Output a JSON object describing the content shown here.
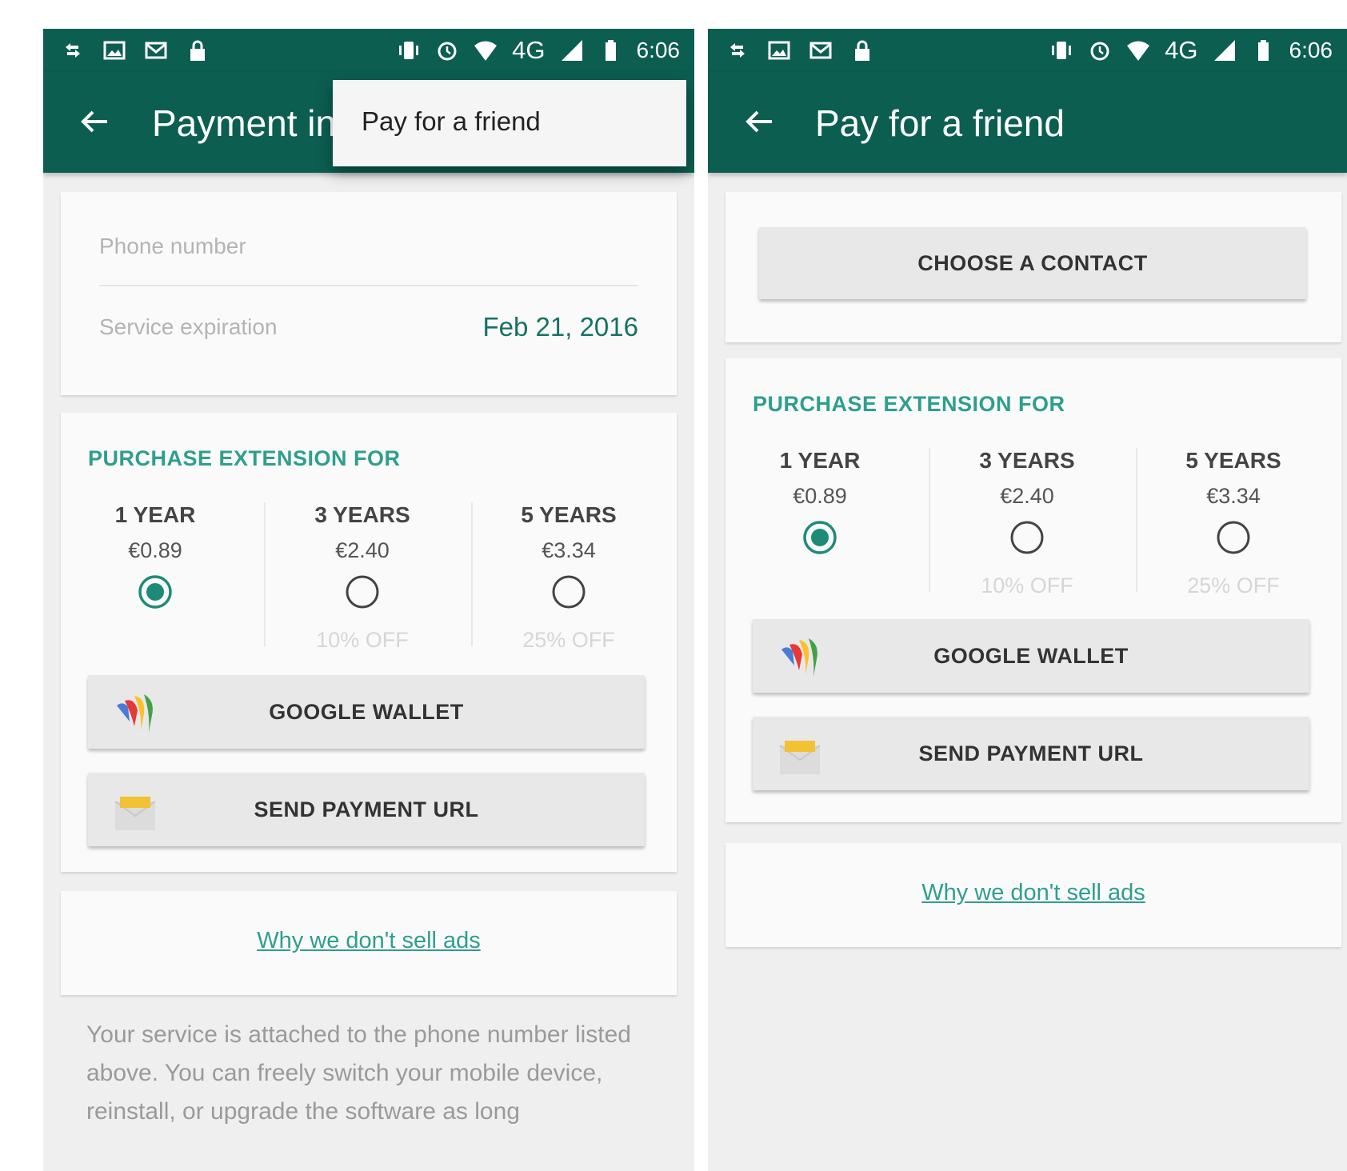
{
  "colors": {
    "primary": "#0c5e51",
    "accent": "#2e9f8d",
    "background": "#efefef"
  },
  "status_bar": {
    "network": "4G",
    "time": "6:06",
    "left_icons": [
      "sync-icon",
      "image-icon",
      "mail-icon",
      "lock-icon"
    ],
    "right_icons": [
      "vibrate-icon",
      "alarm-icon",
      "wifi-icon",
      "signal-icon",
      "battery-icon"
    ]
  },
  "left_screen": {
    "title": "Payment in",
    "overflow_menu": {
      "items": [
        {
          "label": "Pay for a friend"
        }
      ]
    },
    "phone_placeholder": "Phone number",
    "expiration_label": "Service expiration",
    "expiration_value": "Feb 21, 2016",
    "section_header": "PURCHASE EXTENSION FOR",
    "plans": [
      {
        "name": "1 YEAR",
        "price": "€0.89",
        "discount": "",
        "selected": true
      },
      {
        "name": "3 YEARS",
        "price": "€2.40",
        "discount": "10% OFF",
        "selected": false
      },
      {
        "name": "5 YEARS",
        "price": "€3.34",
        "discount": "25% OFF",
        "selected": false
      }
    ],
    "google_wallet_label": "GOOGLE WALLET",
    "send_payment_label": "SEND PAYMENT URL",
    "why_ads_link": "Why we don't sell ads",
    "footer": "Your service is attached to the phone number listed above. You can freely switch your mobile device, reinstall, or upgrade the software as long"
  },
  "right_screen": {
    "title": "Pay for a friend",
    "choose_contact_label": "CHOOSE A CONTACT",
    "section_header": "PURCHASE EXTENSION FOR",
    "plans": [
      {
        "name": "1 YEAR",
        "price": "€0.89",
        "discount": "",
        "selected": true
      },
      {
        "name": "3 YEARS",
        "price": "€2.40",
        "discount": "10% OFF",
        "selected": false
      },
      {
        "name": "5 YEARS",
        "price": "€3.34",
        "discount": "25% OFF",
        "selected": false
      }
    ],
    "google_wallet_label": "GOOGLE WALLET",
    "send_payment_label": "SEND PAYMENT URL",
    "why_ads_link": "Why we don't sell ads"
  }
}
